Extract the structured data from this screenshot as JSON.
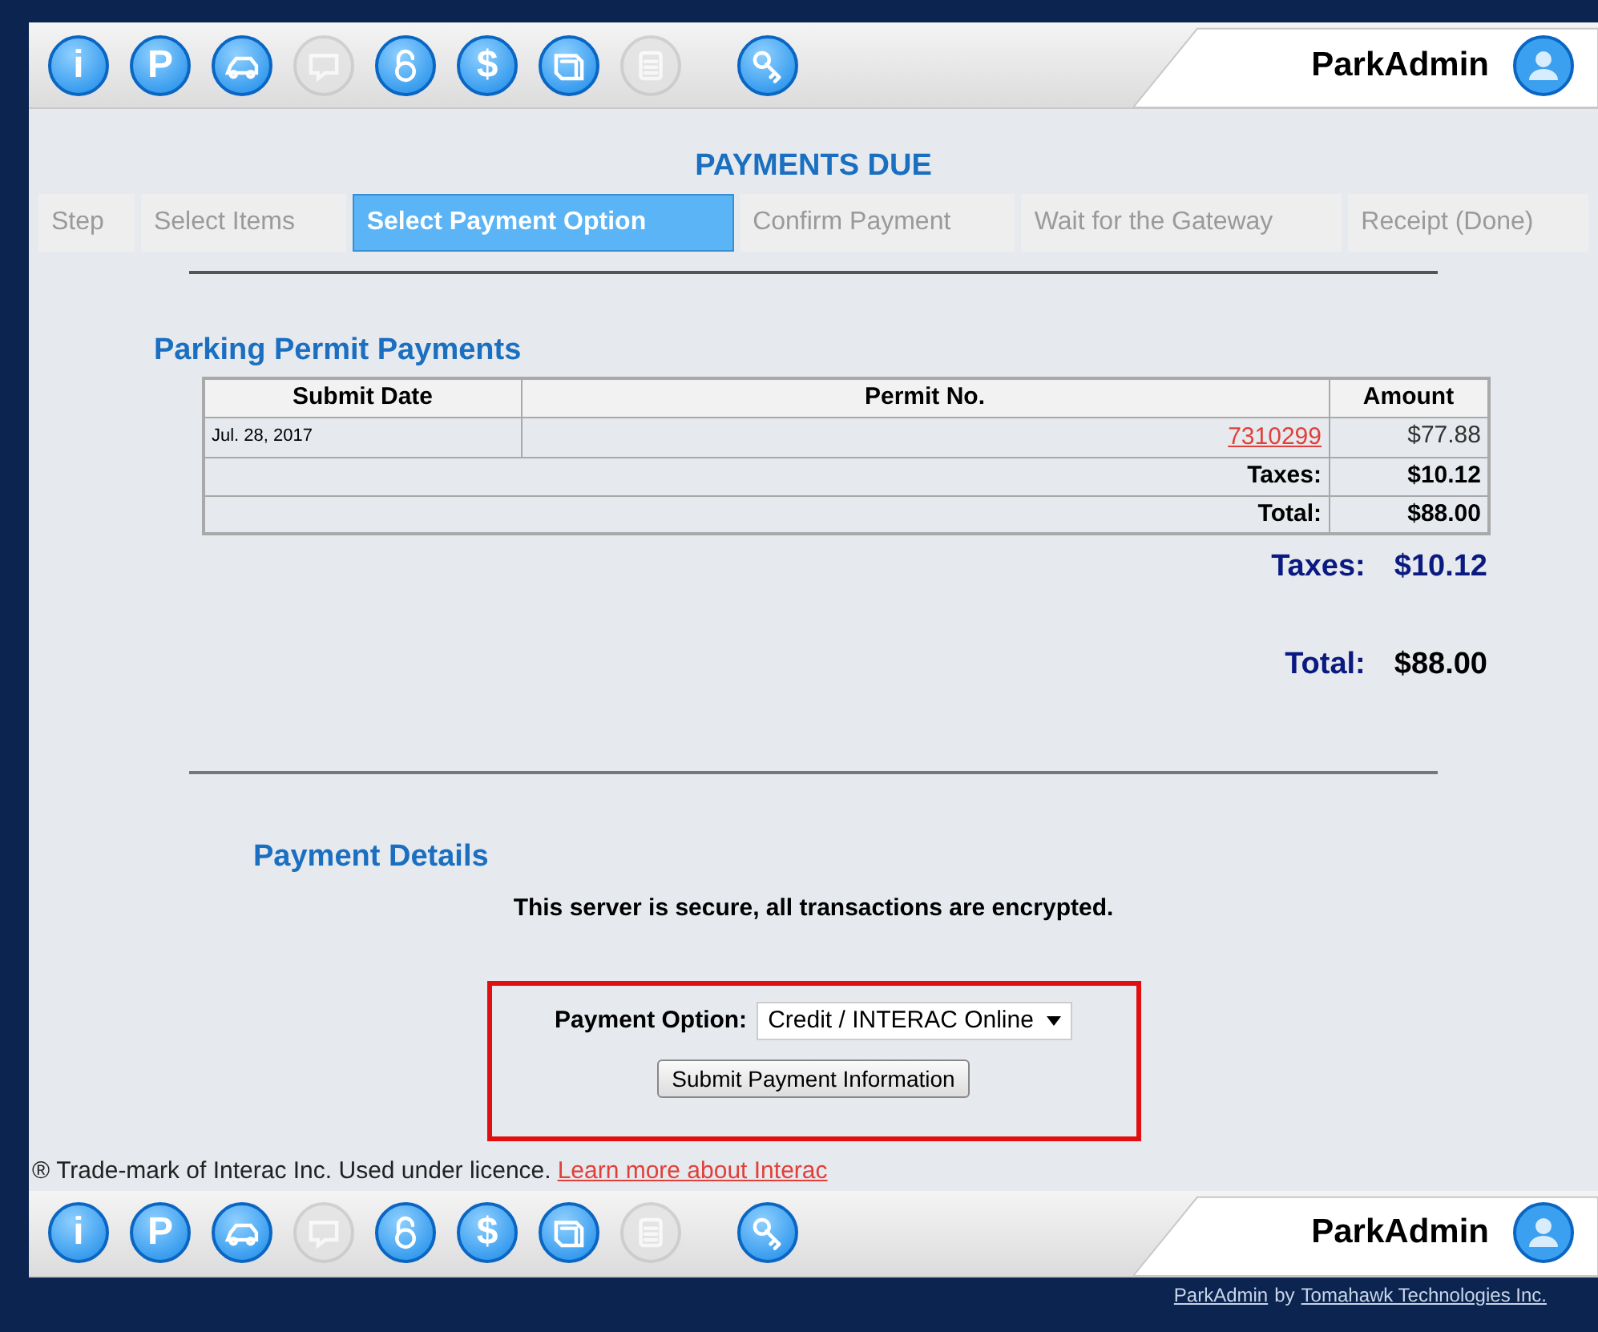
{
  "top_toolbar": {
    "buttons": [
      {
        "kind": "letter",
        "glyph": "i",
        "disabled": false
      },
      {
        "kind": "letter",
        "glyph": "P",
        "disabled": false
      },
      {
        "kind": "car",
        "disabled": false
      },
      {
        "kind": "chat",
        "disabled": true
      },
      {
        "kind": "lock",
        "disabled": false
      },
      {
        "kind": "letter",
        "glyph": "$",
        "disabled": false
      },
      {
        "kind": "book",
        "disabled": false
      },
      {
        "kind": "clipboard",
        "disabled": true
      },
      {
        "kind": "key",
        "disabled": false
      }
    ],
    "brand": "ParkAdmin"
  },
  "page_title": "PAYMENTS DUE",
  "steps": [
    {
      "label": "Step",
      "selected": false
    },
    {
      "label": "Select Items",
      "selected": false
    },
    {
      "label": "Select Payment Option",
      "selected": true
    },
    {
      "label": "Confirm Payment",
      "selected": false
    },
    {
      "label": "Wait for the Gateway",
      "selected": false
    },
    {
      "label": "Receipt (Done)",
      "selected": false
    }
  ],
  "permit_section": {
    "title": "Parking Permit Payments",
    "columns": [
      "Submit Date",
      "Permit No.",
      "Amount"
    ],
    "rows": [
      {
        "submit_date": "Jul. 28, 2017",
        "permit_no": "7310299",
        "amount": "$77.88"
      }
    ],
    "taxes_row": {
      "label": "Taxes:",
      "value": "$10.12"
    },
    "total_row": {
      "label": "Total:",
      "value": "$88.00"
    },
    "taxes_summary": {
      "label": "Taxes:",
      "value": "$10.12"
    },
    "total_summary": {
      "label": "Total:",
      "value": "$88.00"
    }
  },
  "payment_details": {
    "title": "Payment Details",
    "secure_note": "This server is secure, all transactions are encrypted.",
    "option_label": "Payment Option:",
    "option_value": "Credit / INTERAC Online",
    "submit": "Submit Payment Information"
  },
  "trademark": {
    "symbol": "®",
    "text": "Trade-mark of Interac Inc. Used under licence.",
    "link": "Learn more about Interac"
  },
  "bottom_toolbar": {
    "buttons": [
      {
        "kind": "letter",
        "glyph": "i",
        "disabled": false
      },
      {
        "kind": "letter",
        "glyph": "P",
        "disabled": false
      },
      {
        "kind": "car",
        "disabled": false
      },
      {
        "kind": "chat",
        "disabled": true
      },
      {
        "kind": "lock",
        "disabled": false
      },
      {
        "kind": "letter",
        "glyph": "$",
        "disabled": false
      },
      {
        "kind": "book",
        "disabled": false
      },
      {
        "kind": "clipboard",
        "disabled": true
      },
      {
        "kind": "key",
        "disabled": false
      }
    ],
    "brand": "ParkAdmin"
  },
  "footer": {
    "link1": "ParkAdmin",
    "by": "by",
    "link2": "Tomahawk Technologies Inc."
  }
}
